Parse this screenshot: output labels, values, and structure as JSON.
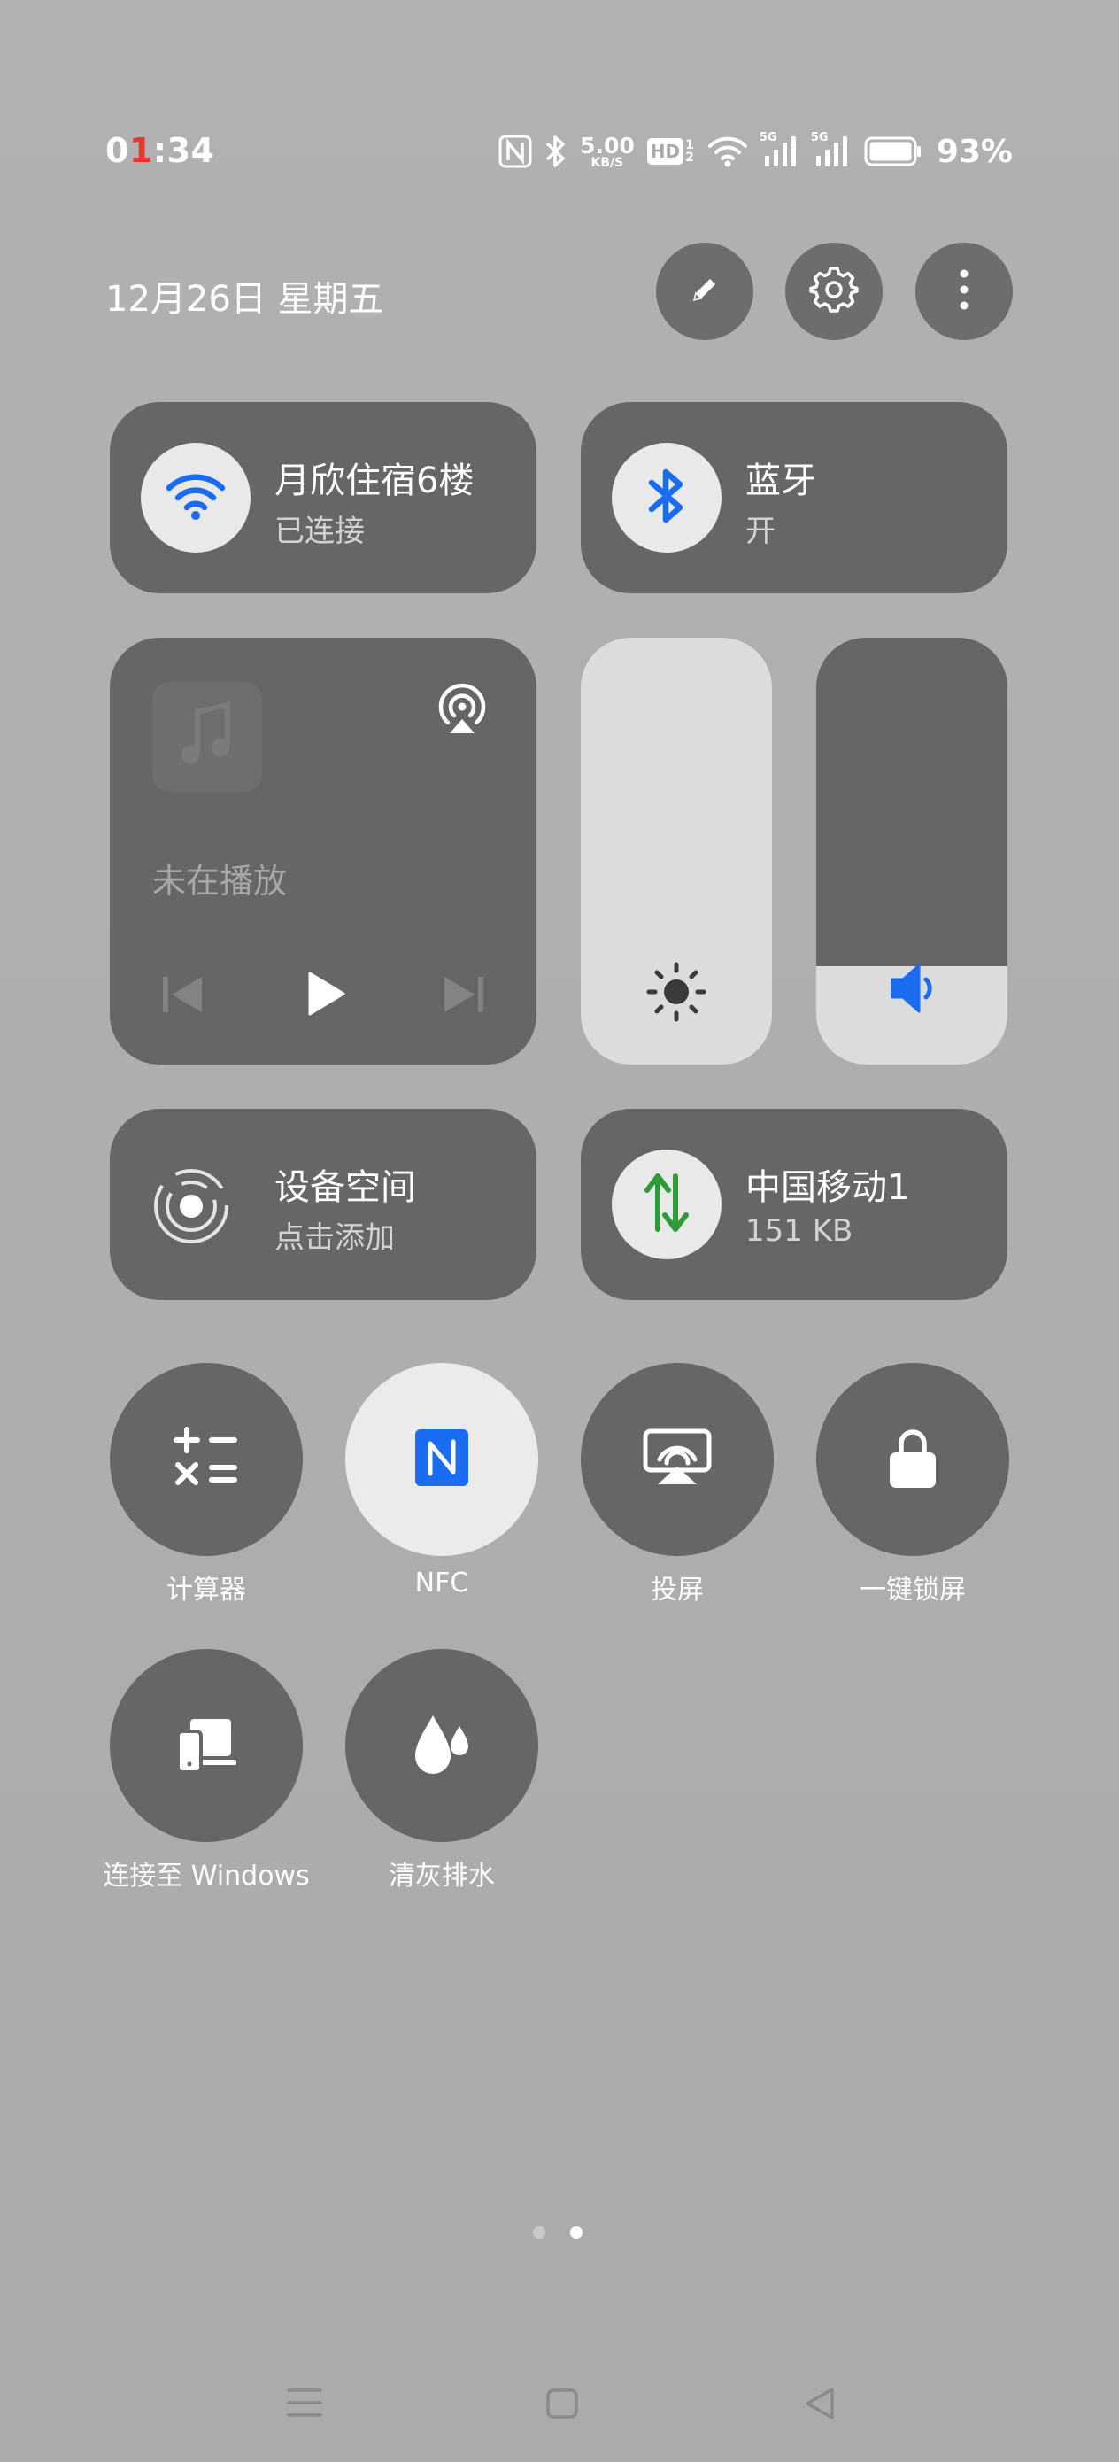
{
  "status_bar": {
    "time_prefix": "0",
    "time_red": "1",
    "time_suffix": ":34",
    "net_speed_value": "5.00",
    "net_speed_unit": "KB/S",
    "hd_label": "HD",
    "sim1_label": "5G",
    "sim2_label": "5G",
    "battery_percent": "93%"
  },
  "header": {
    "date": "12月26日 星期五",
    "icons": [
      "pencil-icon",
      "gear-icon",
      "more-vertical-icon"
    ]
  },
  "tiles": {
    "wifi": {
      "title": "月欣住宿6楼",
      "subtitle": "已连接",
      "icon": "wifi-icon"
    },
    "bluetooth": {
      "title": "蓝牙",
      "subtitle": "开",
      "icon": "bluetooth-icon"
    },
    "media": {
      "status": "未在播放",
      "icons": [
        "music-note-icon",
        "cast-icon",
        "previous-icon",
        "play-icon",
        "next-icon"
      ]
    },
    "brightness": {
      "icon": "sun-icon",
      "level": 1.0
    },
    "volume": {
      "icon": "speaker-icon",
      "level": 0.23
    },
    "device_space": {
      "title": "设备空间",
      "subtitle": "点击添加",
      "icon": "device-space-icon"
    },
    "mobile_data": {
      "title": "中国移动1",
      "subtitle": "151 KB",
      "icon": "data-arrows-icon"
    }
  },
  "toggles": [
    {
      "label": "计算器",
      "icon": "calculator-icon",
      "active": false
    },
    {
      "label": "NFC",
      "icon": "nfc-icon",
      "active": true
    },
    {
      "label": "投屏",
      "icon": "screen-cast-icon",
      "active": false
    },
    {
      "label": "一键锁屏",
      "icon": "lock-icon",
      "active": false
    },
    {
      "label": "连接至 Windows",
      "icon": "connect-windows-icon",
      "active": false
    },
    {
      "label": "清灰排水",
      "icon": "water-drops-icon",
      "active": false
    }
  ],
  "pager": {
    "pages": 2,
    "current": 2
  },
  "nav_bar": {
    "icons": [
      "menu-icon",
      "home-icon",
      "back-icon"
    ]
  },
  "colors": {
    "accent_blue": "#1a6cf0",
    "data_green": "#2e9a3a",
    "tile_bg": "#666666",
    "active_bg": "#ebebeb"
  }
}
